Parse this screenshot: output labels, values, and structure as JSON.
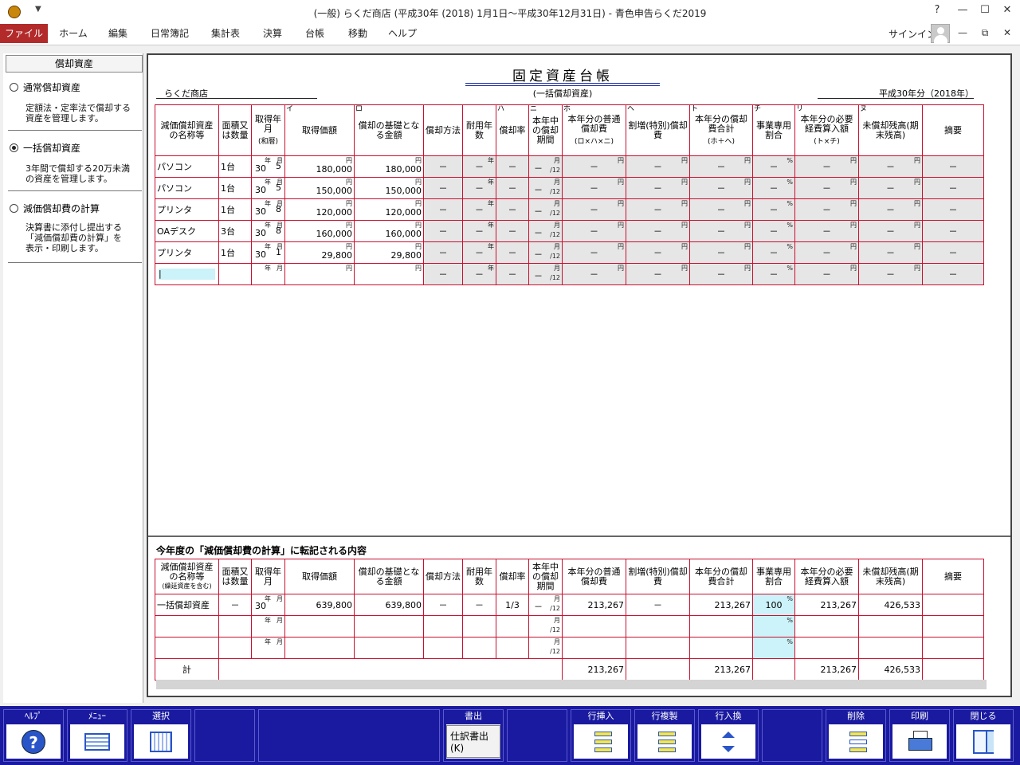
{
  "window": {
    "title": "(一般) らくだ商店 (平成30年 (2018) 1月1日～平成30年12月31日) - 青色申告らくだ2019",
    "quick_access": "▼",
    "controls": [
      "?",
      "—",
      "☐",
      "✕"
    ]
  },
  "ribbon": {
    "tabs": [
      "ファイル",
      "ホーム",
      "編集",
      "日常簿記",
      "集計表",
      "決算",
      "台帳",
      "移動",
      "ヘルプ"
    ],
    "signin": "サインイン",
    "right_controls": [
      "—",
      "⧉",
      "✕"
    ]
  },
  "sidebar": {
    "header": "償却資産",
    "options": [
      {
        "label": "通常償却資産",
        "selected": false,
        "desc": [
          "定額法・定率法で償却する",
          "資産を管理します。"
        ]
      },
      {
        "label": "一括償却資産",
        "selected": true,
        "desc": [
          "3年間で償却する20万未満",
          "の資産を管理します。"
        ]
      },
      {
        "label": "減価償却費の計算",
        "selected": false,
        "desc": [
          "決算書に添付し提出する",
          "「減価償却費の計算」を",
          "表示・印刷します。"
        ]
      }
    ]
  },
  "document": {
    "title": "固定資産台帳",
    "subtitle": "(一括償却資産)",
    "store": "らくだ商店",
    "year": "平成30年分（2018年）"
  },
  "ledger": {
    "headers": [
      {
        "letter": "",
        "text": "減価償却資産の名称等"
      },
      {
        "letter": "",
        "text": "面積又は数量"
      },
      {
        "letter": "",
        "text": "取得年月",
        "sub": "(和暦)"
      },
      {
        "letter": "イ",
        "text": "取得価額"
      },
      {
        "letter": "ロ",
        "text": "償却の基礎となる金額"
      },
      {
        "letter": "",
        "text": "償却方法"
      },
      {
        "letter": "",
        "text": "耐用年数"
      },
      {
        "letter": "ハ",
        "text": "償却率"
      },
      {
        "letter": "ニ",
        "text": "本年中の償却期間"
      },
      {
        "letter": "ホ",
        "text": "本年分の普通償却費",
        "sub": "(ロ×ハ×ニ)"
      },
      {
        "letter": "ヘ",
        "text": "割増(特別)償却費"
      },
      {
        "letter": "ト",
        "text": "本年分の償却費合計",
        "sub": "(ホ＋ヘ)"
      },
      {
        "letter": "チ",
        "text": "事業専用割合"
      },
      {
        "letter": "リ",
        "text": "本年分の必要経費算入額",
        "sub": "(ト×チ)"
      },
      {
        "letter": "ヌ",
        "text": "未償却残高(期末残高)"
      },
      {
        "letter": "",
        "text": "摘要"
      }
    ],
    "units": {
      "year": "年",
      "month": "月",
      "yen": "円",
      "pct": "%",
      "per12": "/12"
    },
    "rows": [
      {
        "name": "パソコン",
        "qty": "1台",
        "yr": "30",
        "mo": "5",
        "cost": "180,000",
        "base": "180,000"
      },
      {
        "name": "パソコン",
        "qty": "1台",
        "yr": "30",
        "mo": "5",
        "cost": "150,000",
        "base": "150,000"
      },
      {
        "name": "プリンタ",
        "qty": "1台",
        "yr": "30",
        "mo": "8",
        "cost": "120,000",
        "base": "120,000"
      },
      {
        "name": "OAデスク",
        "qty": "3台",
        "yr": "30",
        "mo": "8",
        "cost": "160,000",
        "base": "160,000"
      },
      {
        "name": "プリンタ",
        "qty": "1台",
        "yr": "30",
        "mo": "1",
        "cost": "29,800",
        "base": "29,800"
      },
      {
        "name": "|",
        "qty": "",
        "yr": "",
        "mo": "",
        "cost": "",
        "base": ""
      }
    ],
    "dash": "－"
  },
  "summary": {
    "title": "今年度の「減価償却費の計算」に転記される内容",
    "headers": [
      {
        "text": "減価償却資産の名称等",
        "sub": "(繰延資産を含む)"
      },
      {
        "text": "面積又は数量"
      },
      {
        "text": "取得年月"
      },
      {
        "text": "取得価額"
      },
      {
        "text": "償却の基礎となる金額"
      },
      {
        "text": "償却方法"
      },
      {
        "text": "耐用年数"
      },
      {
        "text": "償却率"
      },
      {
        "text": "本年中の償却期間"
      },
      {
        "text": "本年分の普通償却費"
      },
      {
        "text": "割増(特別)償却費"
      },
      {
        "text": "本年分の償却費合計"
      },
      {
        "text": "事業専用割合"
      },
      {
        "text": "本年分の必要経費算入額"
      },
      {
        "text": "未償却残高(期末残高)"
      },
      {
        "text": "摘要"
      }
    ],
    "row": {
      "name": "一括償却資産",
      "qty": "－",
      "yr": "30",
      "cost": "639,800",
      "base": "639,800",
      "method": "－",
      "life": "－",
      "rate": "1/3",
      "period": "－",
      "depr": "213,267",
      "extra": "－",
      "total": "213,267",
      "pct": "100",
      "expense": "213,267",
      "remain": "426,533"
    },
    "total_row": {
      "label": "計",
      "depr": "213,267",
      "total": "213,267",
      "expense": "213,267",
      "remain": "426,533"
    }
  },
  "toolbar": {
    "help": "ﾍﾙﾌﾟ",
    "menu": "ﾒﾆｭｰ",
    "select": "選択",
    "output": "書出",
    "output_btn": "仕訳書出(K)",
    "insert": "行挿入",
    "copy": "行複製",
    "swap": "行入換",
    "delete": "削除",
    "print": "印刷",
    "close": "閉じる"
  }
}
